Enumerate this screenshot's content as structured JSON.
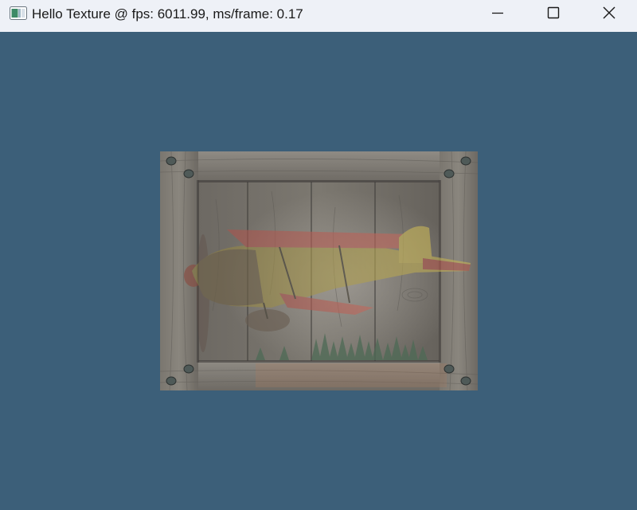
{
  "window": {
    "title": "Hello Texture @ fps: 6011.99, ms/frame: 0.17",
    "clear_color": "#3c5f79"
  },
  "titlebar": {
    "app_icon": "app-window-icon",
    "controls": [
      {
        "name": "minimize-icon"
      },
      {
        "name": "maximize-icon"
      },
      {
        "name": "close-icon"
      }
    ]
  },
  "scene": {
    "quad_textures": [
      "wooden-crate",
      "biplane"
    ],
    "colors": {
      "wood_light": "#8e8a82",
      "wood_dark": "#5f5c57",
      "plane_red": "#b35a52",
      "plane_yellow": "#b9ab4f"
    }
  }
}
